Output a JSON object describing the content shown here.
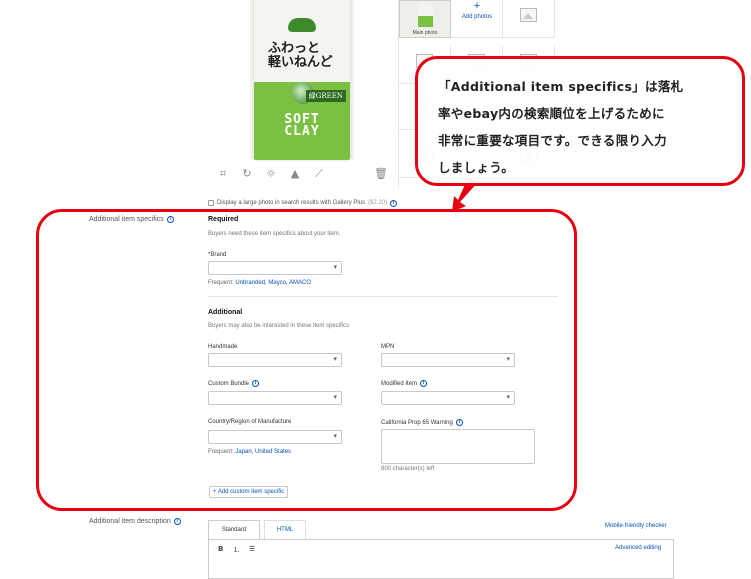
{
  "photos": {
    "main_photo_label": "Main photo",
    "add_photos_label": "Add photos",
    "add_photos_plus": "+",
    "package_text": {
      "jp_line1": "ふわっと",
      "jp_line2": "軽いねんど",
      "green_tag": "緑GREEN",
      "soft": "SOFT",
      "clay": "CLAY"
    },
    "tools": [
      "crop-icon",
      "rotate-icon",
      "brightness-icon",
      "sharpen-icon",
      "magic-wand-icon",
      "trash-icon"
    ]
  },
  "gallery_plus": {
    "label": "Display a large photo in search results with Gallery Plus",
    "price": "($2.20)"
  },
  "item_specifics": {
    "section_label": "Additional item specifics",
    "required_heading": "Required",
    "required_sub": "Buyers need these item specifics about your item.",
    "brand_label": "*Brand",
    "brand_value": "",
    "brand_frequent_prefix": "Frequent:",
    "brand_frequent_links": "Unbranded, Mayco, AMACO",
    "additional_heading": "Additional",
    "additional_sub": "Buyers may also be interested in these item specifics",
    "handmade_label": "Handmade",
    "mpn_label": "MPN",
    "custom_bundle_label": "Custom Bundle",
    "modified_item_label": "Modified Item",
    "country_label": "Country/Region of Manufacture",
    "country_frequent_prefix": "Frequent:",
    "country_frequent_links": "Japan, United States",
    "prop65_label": "California Prop 65 Warning",
    "prop65_counter": "800 character(s) left",
    "add_custom_button": "+ Add custom item specific"
  },
  "description": {
    "section_label": "Additional item description",
    "tab_standard": "Standard",
    "tab_html": "HTML",
    "mobile_link": "Mobile-friendly checker",
    "advanced_link": "Advanced editing",
    "bold_btn": "B"
  },
  "callout": {
    "line1": "「Additional item specifics」は落札",
    "line2": "率やebay内の検索順位を上げるために",
    "line3": "非常に重要な項目です。できる限り入力",
    "line4": "しましょう。"
  },
  "colors": {
    "accent_red": "#e60012",
    "link_blue": "#0654ba",
    "clay_green": "#7bc043"
  }
}
